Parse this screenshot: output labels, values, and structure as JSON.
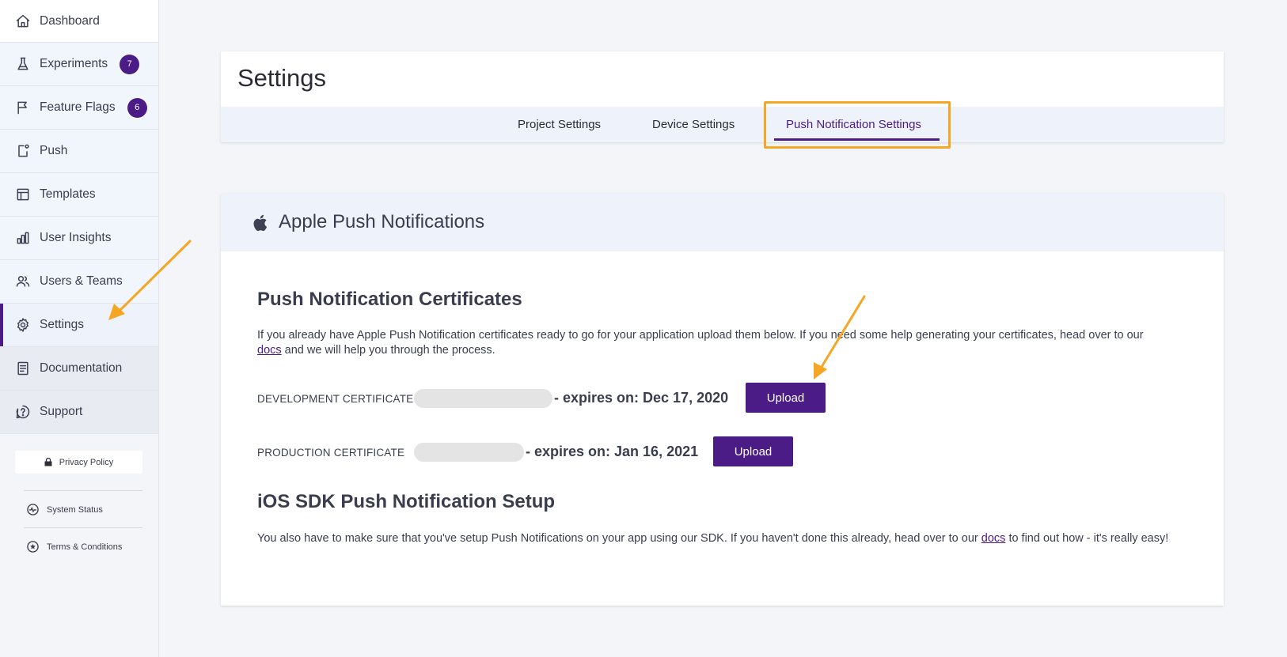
{
  "sidebar": {
    "items": [
      {
        "label": "Dashboard",
        "icon": "home-icon"
      },
      {
        "label": "Experiments",
        "icon": "flask-icon",
        "badge": "7"
      },
      {
        "label": "Feature Flags",
        "icon": "flag-icon",
        "badge": "6"
      },
      {
        "label": "Push",
        "icon": "push-icon"
      },
      {
        "label": "Templates",
        "icon": "template-icon"
      },
      {
        "label": "User Insights",
        "icon": "bar-chart-icon"
      },
      {
        "label": "Users & Teams",
        "icon": "users-icon"
      },
      {
        "label": "Settings",
        "icon": "gear-icon",
        "active": true
      },
      {
        "label": "Documentation",
        "icon": "document-icon"
      },
      {
        "label": "Support",
        "icon": "help-icon"
      }
    ],
    "privacy_policy": "Privacy Policy",
    "system_status": "System Status",
    "terms": "Terms & Conditions"
  },
  "settings": {
    "title": "Settings",
    "tabs": [
      "Project Settings",
      "Device Settings",
      "Push Notification Settings"
    ],
    "active_tab": "Push Notification Settings"
  },
  "apple": {
    "title": "Apple Push Notifications",
    "certs_title": "Push Notification Certificates",
    "certs_text_1": "If you already have Apple Push Notification certificates ready to go for your application upload them below. If you need some help generating your certificates, head over to our",
    "docs_link": "docs",
    "certs_text_2": "and we will help you through the process.",
    "dev_label": "DEVELOPMENT CERTIFICATE",
    "dev_expires": "- expires on: Dec 17, 2020",
    "prod_label": "PRODUCTION CERTIFICATE",
    "prod_expires": "- expires on: Jan 16, 2021",
    "upload_label": "Upload",
    "sdk_title": "iOS SDK Push Notification Setup",
    "sdk_text_1": "You also have to make sure that you've setup Push Notifications on your app using our SDK. If you haven't done this already, head over to our",
    "sdk_text_2": "to find out how - it's really easy!"
  },
  "colors": {
    "brand": "#4b1b86",
    "highlight": "#f5a623"
  }
}
